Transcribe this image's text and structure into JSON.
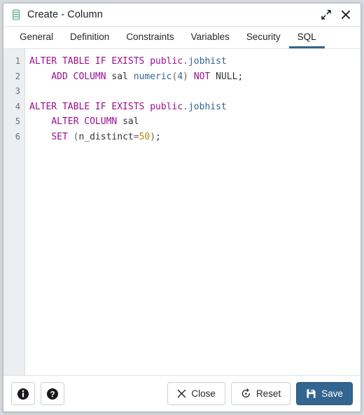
{
  "window": {
    "title": "Create - Column",
    "icon": "column-icon",
    "controls": [
      {
        "name": "expand-icon",
        "label": "Expand"
      },
      {
        "name": "close-icon",
        "label": "Close"
      }
    ]
  },
  "tabs": [
    {
      "label": "General",
      "active": false
    },
    {
      "label": "Definition",
      "active": false
    },
    {
      "label": "Constraints",
      "active": false
    },
    {
      "label": "Variables",
      "active": false
    },
    {
      "label": "Security",
      "active": false
    },
    {
      "label": "SQL",
      "active": true
    }
  ],
  "editor": {
    "line_numbers": [
      "1",
      "2",
      "3",
      "4",
      "5",
      "6"
    ],
    "lines": [
      "ALTER TABLE IF EXISTS public.jobhist",
      "    ADD COLUMN sal numeric(4) NOT NULL;",
      "",
      "ALTER TABLE IF EXISTS public.jobhist",
      "    ALTER COLUMN sal",
      "    SET (n_distinct=50);"
    ],
    "tokens": [
      [
        {
          "t": "ALTER TABLE IF EXISTS ",
          "c": "k"
        },
        {
          "t": "public",
          "c": "k"
        },
        {
          "t": ".",
          "c": "pn"
        },
        {
          "t": "jobhist",
          "c": "id"
        }
      ],
      [
        {
          "t": "    ",
          "c": "pl"
        },
        {
          "t": "ADD COLUMN ",
          "c": "k"
        },
        {
          "t": "sal ",
          "c": "pl"
        },
        {
          "t": "numeric",
          "c": "id"
        },
        {
          "t": "(",
          "c": "pn"
        },
        {
          "t": "4",
          "c": "id"
        },
        {
          "t": ")",
          "c": "pn"
        },
        {
          "t": " ",
          "c": "pl"
        },
        {
          "t": "NOT",
          "c": "k"
        },
        {
          "t": " NULL;",
          "c": "pl"
        }
      ],
      [],
      [
        {
          "t": "ALTER TABLE IF EXISTS ",
          "c": "k"
        },
        {
          "t": "public",
          "c": "k"
        },
        {
          "t": ".",
          "c": "pn"
        },
        {
          "t": "jobhist",
          "c": "id"
        }
      ],
      [
        {
          "t": "    ",
          "c": "pl"
        },
        {
          "t": "ALTER COLUMN ",
          "c": "k"
        },
        {
          "t": "sal",
          "c": "pl"
        }
      ],
      [
        {
          "t": "    ",
          "c": "pl"
        },
        {
          "t": "SET",
          "c": "k"
        },
        {
          "t": " ",
          "c": "pl"
        },
        {
          "t": "(",
          "c": "pn"
        },
        {
          "t": "n_distinct",
          "c": "pl"
        },
        {
          "t": "=",
          "c": "pn"
        },
        {
          "t": "50",
          "c": "num"
        },
        {
          "t": ")",
          "c": "pn"
        },
        {
          "t": ";",
          "c": "pl"
        }
      ]
    ]
  },
  "footer": {
    "info_label": "Info",
    "help_label": "Help",
    "close_label": "Close",
    "reset_label": "Reset",
    "save_label": "Save"
  },
  "colors": {
    "accent": "#32658f",
    "keyword": "#9b0f8f",
    "identifier": "#32658f",
    "number": "#b8860b",
    "gutter_bg": "#eceef1",
    "icon_green": "#a8d5bd"
  }
}
